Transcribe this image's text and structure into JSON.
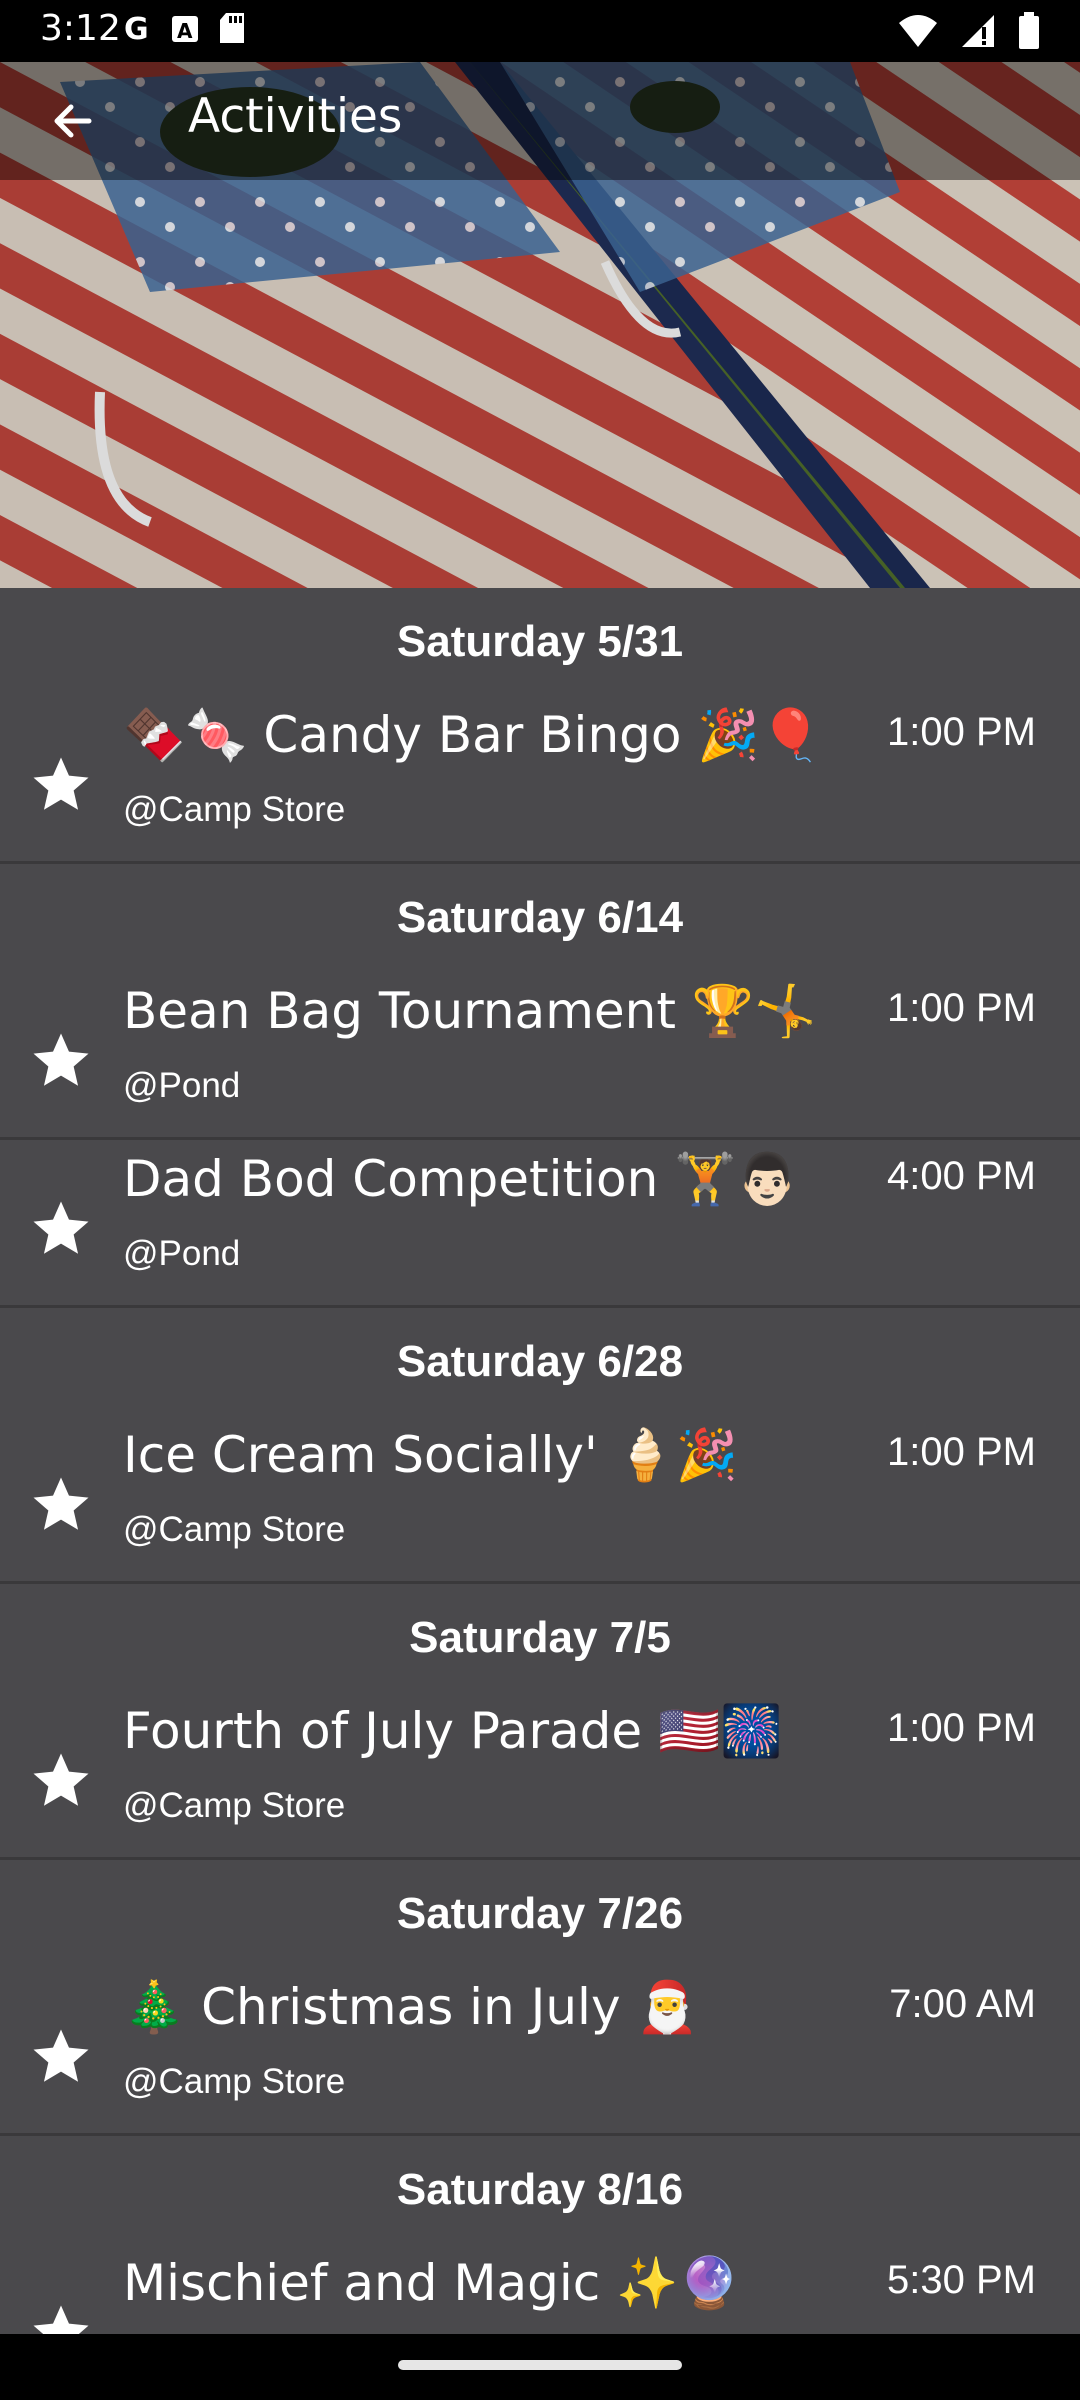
{
  "status_bar": {
    "time": "3:12",
    "left_icons": [
      "google-icon",
      "text-icon",
      "sd-card-icon"
    ],
    "right_icons": [
      "wifi-icon",
      "signal-icon",
      "battery-icon"
    ]
  },
  "app_bar": {
    "title": "Activities",
    "back_icon": "arrow-left-icon"
  },
  "hero_image": {
    "description_name": "cornhole-boards-american-flag"
  },
  "sections": [
    {
      "date": "Saturday 5/31",
      "items": [
        {
          "title": "🍫🍬 Candy Bar Bingo 🎉🎈",
          "location": "@Camp Store",
          "time": "1:00 PM"
        }
      ]
    },
    {
      "date": "Saturday 6/14",
      "items": [
        {
          "title": "Bean Bag Tournament 🏆🤸",
          "location": "@Pond",
          "time": "1:00 PM"
        },
        {
          "title": "Dad Bod Competition 🏋️👨🏻",
          "location": "@Pond",
          "time": "4:00 PM"
        }
      ]
    },
    {
      "date": "Saturday 6/28",
      "items": [
        {
          "title": "Ice Cream Socially' 🍦🎉",
          "location": "@Camp Store",
          "time": "1:00 PM"
        }
      ]
    },
    {
      "date": "Saturday 7/5",
      "items": [
        {
          "title": "Fourth of July Parade 🇺🇸🎆",
          "location": "@Camp Store",
          "time": "1:00 PM"
        }
      ]
    },
    {
      "date": "Saturday 7/26",
      "items": [
        {
          "title": "🎄 Christmas in July 🎅",
          "location": "@Camp Store",
          "time": "7:00 AM"
        }
      ]
    },
    {
      "date": "Saturday 8/16",
      "items": [
        {
          "title": "Mischief and Magic ✨🔮",
          "location": "",
          "time": "5:30 PM"
        }
      ]
    }
  ],
  "colors": {
    "background": "#4a494c",
    "text": "#ffffff",
    "divider": "#3a393b"
  }
}
